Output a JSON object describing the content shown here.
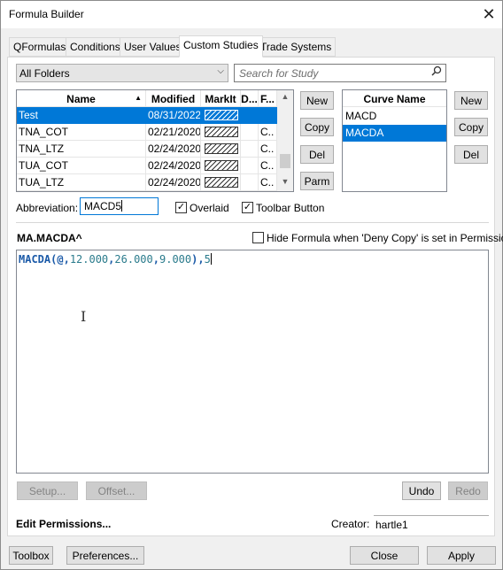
{
  "window": {
    "title": "Formula Builder",
    "close_glyph": "✕"
  },
  "tabs": [
    "QFormulas",
    "Conditions",
    "User Values",
    "Custom Studies",
    "Trade Systems"
  ],
  "folder": {
    "selected": "All Folders",
    "arrow": "⌵"
  },
  "search": {
    "placeholder": "Search for Study",
    "icon": "magnifier-icon"
  },
  "study_table": {
    "columns": [
      "Name",
      "Modified",
      "MarkIt",
      "D...",
      "F..."
    ],
    "sort_arrow": "▲",
    "rows": [
      {
        "name": "Test",
        "modified": "08/31/2022",
        "f": "",
        "selected": true
      },
      {
        "name": "TNA_COT",
        "modified": "02/21/2020",
        "f": "C..",
        "selected": false
      },
      {
        "name": "TNA_LTZ",
        "modified": "02/24/2020",
        "f": "C..",
        "selected": false
      },
      {
        "name": "TUA_COT",
        "modified": "02/24/2020",
        "f": "C..",
        "selected": false
      },
      {
        "name": "TUA_LTZ",
        "modified": "02/24/2020",
        "f": "C..",
        "selected": false
      }
    ]
  },
  "study_buttons": {
    "new": "New",
    "copy": "Copy",
    "del": "Del",
    "parm": "Parm"
  },
  "curves": {
    "header": "Curve Name",
    "items": [
      "MACD",
      "MACDA"
    ],
    "selected": "MACDA"
  },
  "curve_buttons": {
    "new": "New",
    "copy": "Copy",
    "del": "Del"
  },
  "abbreviation": {
    "label": "Abbreviation:",
    "value": "MACD5"
  },
  "overlaid": {
    "label": "Overlaid",
    "checked": true
  },
  "toolbar_button": {
    "label": "Toolbar Button",
    "checked": true
  },
  "formula_header": "MA.MACDA^",
  "hide_formula": {
    "label": "Hide Formula when 'Deny Copy' is set in Permissions",
    "checked": false
  },
  "formula": {
    "fn": "MACDA(",
    "at": "@,",
    "p1": "12.000",
    "c1": ",",
    "p2": "26.000",
    "c2": ",",
    "p3": "9.000",
    "close": "),",
    "p4": "5"
  },
  "editor_buttons": {
    "setup": "Setup...",
    "offset": "Offset...",
    "undo": "Undo",
    "redo": "Redo"
  },
  "edit_permissions": "Edit Permissions...",
  "creator": {
    "label": "Creator:",
    "value": "hartle1"
  },
  "footer": {
    "toolbox": "Toolbox",
    "preferences": "Preferences...",
    "close": "Close",
    "apply": "Apply"
  }
}
